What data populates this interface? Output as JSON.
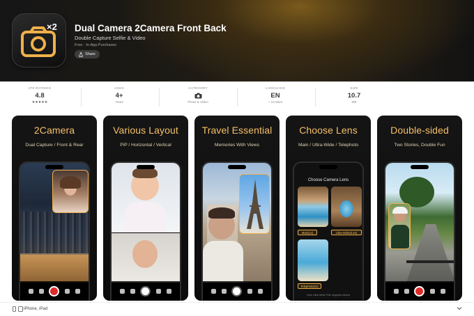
{
  "app": {
    "title": "Dual Camera 2Camera Front Back",
    "subtitle": "Double Capture Selfie & Video",
    "price": "Free · In-App Purchases",
    "share_label": "Share",
    "icon_text": "×2",
    "icon_name": "camera-icon",
    "accent": "#f0b04b"
  },
  "info": [
    {
      "label": "278 RATINGS",
      "value": "4.8",
      "sub": "★★★★★"
    },
    {
      "label": "AGES",
      "value": "4+",
      "sub": "Years"
    },
    {
      "label": "CATEGORY",
      "value": "",
      "sub": "Photo & Video",
      "icon": "camera-icon"
    },
    {
      "label": "LANGUAGE",
      "value": "EN",
      "sub": "+ 16 More"
    },
    {
      "label": "SIZE",
      "value": "10.7",
      "sub": "MB"
    }
  ],
  "screenshots": [
    {
      "title": "2Camera",
      "subtitle": "Dual Capture / Front & Rear"
    },
    {
      "title": "Various Layout",
      "subtitle": "PiP / Horizontal / Vertical"
    },
    {
      "title": "Travel Essential",
      "subtitle": "Memories With Views"
    },
    {
      "title": "Choose Lens",
      "subtitle": "Main / Ultra-Wide / Telephoto",
      "screen_title": "Choose Camera Lens",
      "lens_main": "Main(1x)",
      "lens_ultra": "Ultra-Wide(0.5x)",
      "lens_tele": "Telephoto(2x)",
      "footnote": "Lens Ultra Wide Tele supports device"
    },
    {
      "title": "Double-sided",
      "subtitle": "Two Stories, Double Fun"
    }
  ],
  "footer": {
    "devices_label": "iPhone, iPad"
  }
}
